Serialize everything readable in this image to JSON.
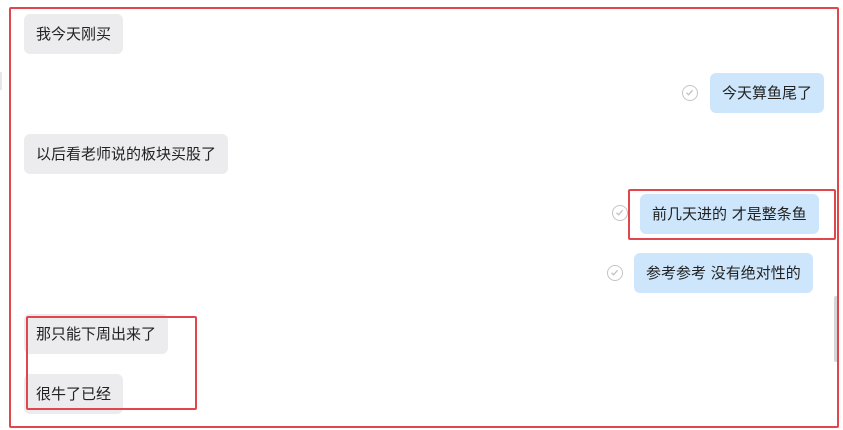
{
  "messages": [
    {
      "side": "received",
      "text": "我今天刚买"
    },
    {
      "side": "sent",
      "text": "今天算鱼尾了",
      "status_icon": "read-check-icon"
    },
    {
      "side": "received",
      "text": "以后看老师说的板块买股了"
    },
    {
      "side": "sent",
      "text": "前几天进的 才是整条鱼",
      "status_icon": "read-check-icon",
      "highlighted": true
    },
    {
      "side": "sent",
      "text": "参考参考  没有绝对性的",
      "status_icon": "read-check-icon"
    },
    {
      "side": "received",
      "text": "那只能下周出来了",
      "highlighted": true
    },
    {
      "side": "received",
      "text": "很牛了已经",
      "highlighted": true
    }
  ],
  "colors": {
    "received_bubble": "#ececef",
    "sent_bubble": "#cde6fb",
    "highlight_border": "#e0474c"
  }
}
